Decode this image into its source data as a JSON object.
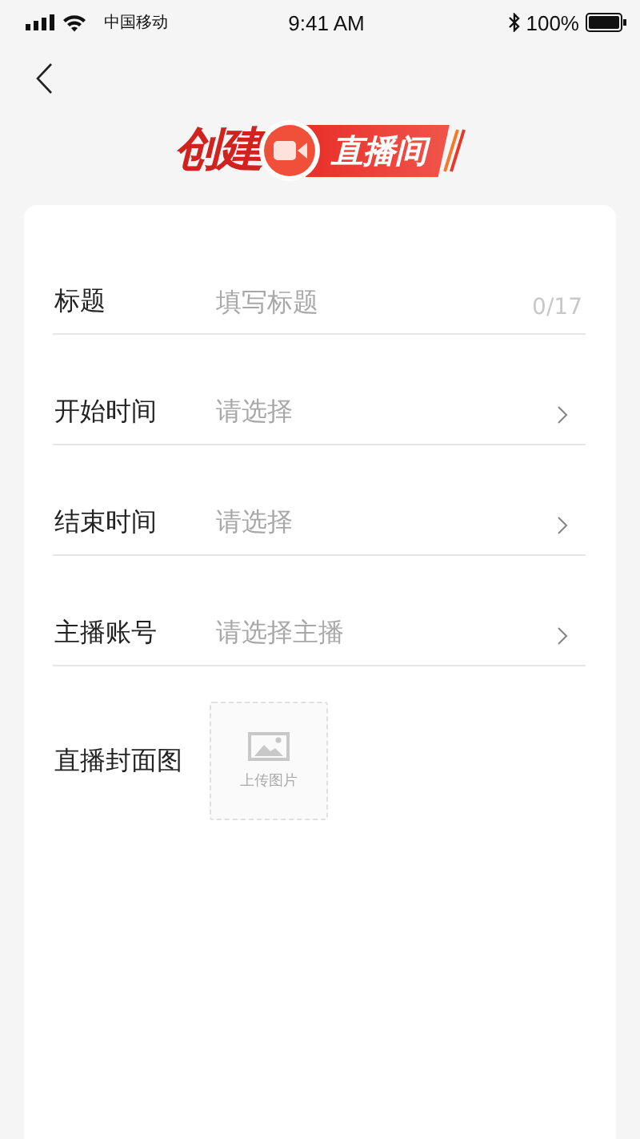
{
  "status_bar": {
    "carrier": "中国移动",
    "time": "9:41 AM",
    "battery": "100%"
  },
  "logo": {
    "left": "创建",
    "right": "直播间"
  },
  "form": {
    "rows": [
      {
        "kind": "text",
        "label": "标题",
        "placeholder": "填写标题",
        "counter": "0/17"
      },
      {
        "kind": "select",
        "label": "开始时间",
        "placeholder": "请选择"
      },
      {
        "kind": "select",
        "label": "结束时间",
        "placeholder": "请选择"
      },
      {
        "kind": "select",
        "label": "主播账号",
        "placeholder": "请选择主播"
      }
    ],
    "cover": {
      "label": "直播封面图",
      "upload_text": "上传图片"
    }
  }
}
